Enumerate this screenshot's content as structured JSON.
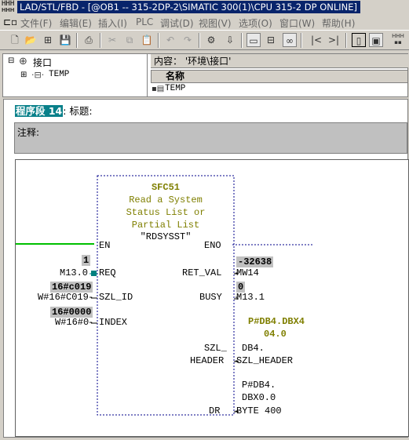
{
  "window": {
    "title": "LAD/STL/FBD  - [@OB1 -- 315-2DP-2\\SIMATIC 300(1)\\CPU 315-2 DP  ONLINE]"
  },
  "menu": {
    "items": [
      "文件(F)",
      "编辑(E)",
      "插入(I)",
      "PLC",
      "调试(D)",
      "视图(V)",
      "选项(O)",
      "窗口(W)",
      "帮助(H)"
    ]
  },
  "declaration": {
    "tree_root": "接口",
    "tree_child": "TEMP",
    "content_label": "内容：  '环境\\接口'",
    "column_name": "名称",
    "row_name": "TEMP"
  },
  "network": {
    "label": "程序段 14",
    "title_label": ": 标题:",
    "comment_label": "注释:"
  },
  "block": {
    "name": "SFC51",
    "desc_lines": [
      "Read a System",
      "Status List or",
      "Partial List"
    ],
    "symbol": "\"RDSYSST\"",
    "pins": {
      "en": "EN",
      "eno": "ENO",
      "req": "REQ",
      "ret_val": "RET_VAL",
      "szl_id": "SZL_ID",
      "busy": "BUSY",
      "index": "INDEX",
      "szl_header_1": "SZL_",
      "szl_header_2": "HEADER",
      "dr": "DR"
    }
  },
  "operands": {
    "req_status": "1",
    "req_operand": "M13.0",
    "szl_id_status": "16#c019",
    "szl_id_operand": "W#16#C019",
    "index_status": "16#0000",
    "index_operand": "W#16#0",
    "ret_val_status": "-32638",
    "ret_val_operand": "MW14",
    "busy_status": "0",
    "busy_operand": "M13.1",
    "header_status_1": "P#DB4.DBX4",
    "header_status_2": "04.0",
    "header_operand_1": "DB4.",
    "header_operand_2": "SZL_HEADER",
    "dr_operand_1": "P#DB4.",
    "dr_operand_2": "DBX0.0",
    "dr_operand_3": "BYTE 400"
  },
  "colors": {
    "title_bar": "#08246b",
    "network_label_bg": "#08808a",
    "power_flow": "#00c000",
    "block_outline": "#00008b",
    "status_olive": "#7f7f00",
    "status_bg": "#c0c0c0"
  }
}
